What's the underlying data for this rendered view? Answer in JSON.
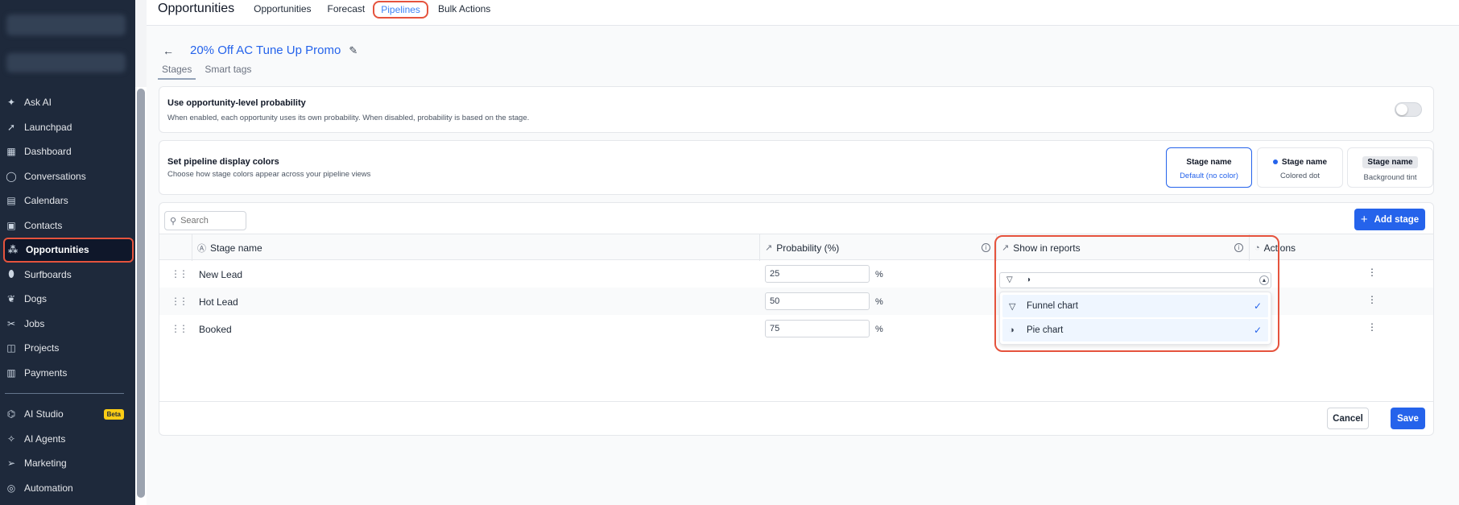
{
  "sidebar": {
    "items": [
      {
        "label": "Ask AI",
        "icon": "sparkle-icon",
        "glyph": "✦"
      },
      {
        "label": "Launchpad",
        "icon": "rocket-icon",
        "glyph": "➚"
      },
      {
        "label": "Dashboard",
        "icon": "grid-icon",
        "glyph": "▦"
      },
      {
        "label": "Conversations",
        "icon": "chat-icon",
        "glyph": "◯"
      },
      {
        "label": "Calendars",
        "icon": "calendar-icon",
        "glyph": "▤"
      },
      {
        "label": "Contacts",
        "icon": "contacts-icon",
        "glyph": "▣"
      },
      {
        "label": "Opportunities",
        "icon": "network-icon",
        "glyph": "⁂",
        "active": true
      },
      {
        "label": "Surfboards",
        "icon": "surfboard-icon",
        "glyph": "⬮"
      },
      {
        "label": "Dogs",
        "icon": "dog-icon",
        "glyph": "❦"
      },
      {
        "label": "Jobs",
        "icon": "tools-icon",
        "glyph": "✂"
      },
      {
        "label": "Projects",
        "icon": "projects-icon",
        "glyph": "◫"
      },
      {
        "label": "Payments",
        "icon": "receipt-icon",
        "glyph": "▥"
      }
    ],
    "items2": [
      {
        "label": "AI Studio",
        "icon": "ai-studio-icon",
        "glyph": "⌬",
        "badge": "Beta"
      },
      {
        "label": "AI Agents",
        "icon": "agents-icon",
        "glyph": "✧"
      },
      {
        "label": "Marketing",
        "icon": "send-icon",
        "glyph": "➢"
      },
      {
        "label": "Automation",
        "icon": "automation-icon",
        "glyph": "◎"
      }
    ]
  },
  "topbar": {
    "title": "Opportunities",
    "tabs": [
      "Opportunities",
      "Forecast",
      "Pipelines",
      "Bulk Actions"
    ],
    "active_tab": "Pipelines"
  },
  "pipeline": {
    "back": "←",
    "name": "20% Off AC Tune Up Promo",
    "subtabs": [
      "Stages",
      "Smart tags"
    ]
  },
  "probability_card": {
    "title": "Use opportunity-level probability",
    "subtitle": "When enabled, each opportunity uses its own probability. When disabled, probability is based on the stage.",
    "enabled": false
  },
  "colors_card": {
    "title": "Set pipeline display colors",
    "subtitle": "Choose how stage colors appear across your pipeline views",
    "options": [
      {
        "title": "Stage name",
        "sub": "Default (no color)",
        "selected": true
      },
      {
        "title": "Stage name",
        "sub": "Colored dot"
      },
      {
        "title": "Stage name",
        "sub": "Background tint"
      }
    ],
    "accent": "#2563eb"
  },
  "table": {
    "search_placeholder": "Search",
    "add_label": "Add stage",
    "headers": {
      "stage": "Stage name",
      "probability": "Probability (%)",
      "reports": "Show in reports",
      "actions": "Actions"
    },
    "rows": [
      {
        "name": "New Lead",
        "probability": "25",
        "pct": "%"
      },
      {
        "name": "Hot Lead",
        "probability": "50",
        "pct": "%"
      },
      {
        "name": "Booked",
        "probability": "75",
        "pct": "%"
      }
    ],
    "dropdown": {
      "options": [
        {
          "label": "Funnel chart",
          "icon": "funnel-icon",
          "checked": true
        },
        {
          "label": "Pie chart",
          "icon": "pie-icon",
          "checked": true
        }
      ]
    },
    "cancel_label": "Cancel",
    "save_label": "Save"
  }
}
